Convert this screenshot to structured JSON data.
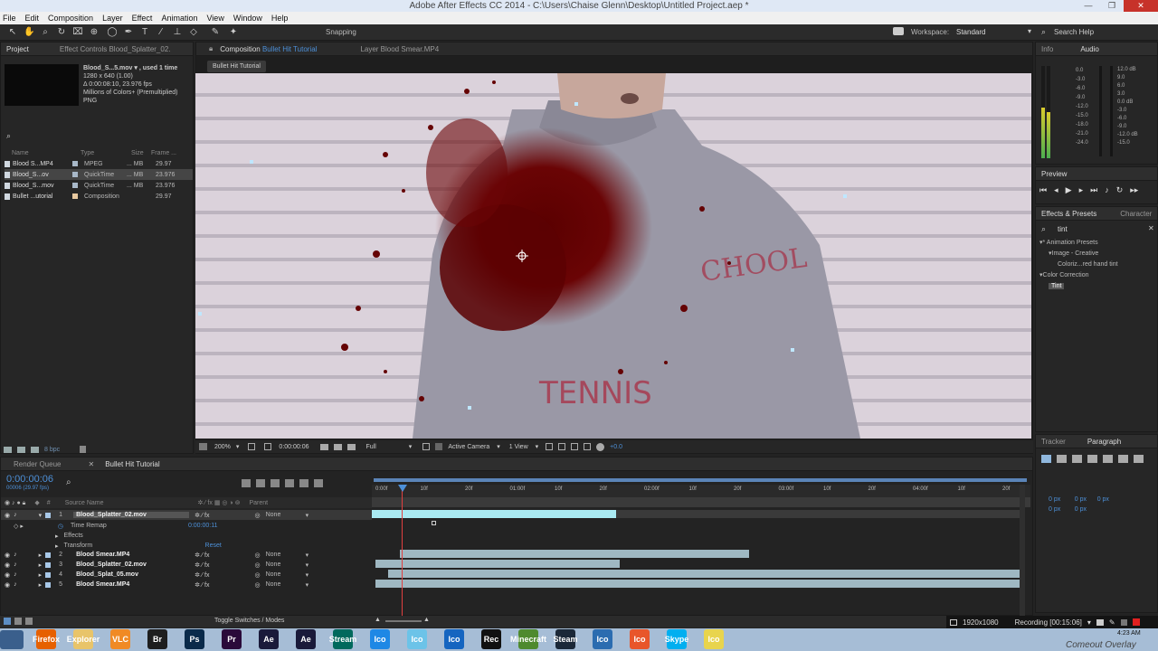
{
  "titlebar": {
    "title": "Adobe After Effects CC 2014 - C:\\Users\\Chaise Glenn\\Desktop\\Untitled Project.aep *"
  },
  "menu": [
    "File",
    "Edit",
    "Composition",
    "Layer",
    "Effect",
    "Animation",
    "View",
    "Window",
    "Help"
  ],
  "toolbar": {
    "snapping": "Snapping",
    "workspace_label": "Workspace:",
    "workspace_value": "Standard",
    "search_help": "Search Help"
  },
  "project": {
    "tab": "Project",
    "effect_controls_tab": "Effect Controls Blood_Splatter_02.",
    "selected_info": [
      "Blood_S...5.mov ▾ , used 1 time",
      "1280 x 640 (1.00)",
      "Δ 0:00:08:10, 23.976 fps",
      "Millions of Colors+ (Premultiplied)",
      "PNG"
    ],
    "columns": [
      "Name",
      "Type",
      "Size",
      "Frame ..."
    ],
    "items": [
      {
        "name": "Blood S...MP4",
        "type": "MPEG",
        "size": "... MB",
        "fps": "29.97",
        "color": "#a8b8c8"
      },
      {
        "name": "Blood_S...ov",
        "type": "QuickTime",
        "size": "... MB",
        "fps": "23.976",
        "color": "#a8b8c8"
      },
      {
        "name": "Blood_S...mov",
        "type": "QuickTime",
        "size": "... MB",
        "fps": "23.976",
        "color": "#a8b8c8"
      },
      {
        "name": "Bullet ...utorial",
        "type": "Composition",
        "size": "",
        "fps": "29.97",
        "color": "#e8c9a0"
      }
    ],
    "bpc": "8 bpc"
  },
  "composition": {
    "tab_label": "Composition",
    "tab_name": "Bullet Hit Tutorial",
    "layer_tab": "Layer Blood Smear.MP4",
    "subtab": "Bullet Hit Tutorial",
    "zoom": "200%",
    "timecode": "0:00:00:06",
    "resolution": "Full",
    "camera": "Active Camera",
    "view": "1 View",
    "exposure": "+0.0"
  },
  "info_panel": {
    "info_tab": "Info",
    "audio_tab": "Audio",
    "left_scale": [
      "0.0",
      "-3.0",
      "-6.0",
      "-9.0",
      "-12.0",
      "-15.0",
      "-18.0",
      "-21.0",
      "-24.0"
    ],
    "right_scale": [
      "12.0 dB",
      "9.0",
      "6.0",
      "3.0",
      "0.0 dB",
      "-3.0",
      "-6.0",
      "-9.0",
      "-12.0 dB",
      "-15.0"
    ],
    "meter_level_left": 0.55,
    "meter_level_right": 0.5
  },
  "preview": {
    "tab": "Preview"
  },
  "effects": {
    "tab": "Effects & Presets",
    "character_tab": "Character",
    "search": "tint",
    "tree": [
      {
        "label": "* Animation Presets",
        "indent": 0
      },
      {
        "label": "Image - Creative",
        "indent": 1
      },
      {
        "label": "Coloriz...red hand tint",
        "indent": 2
      },
      {
        "label": "Color Correction",
        "indent": 0
      },
      {
        "label": "Tint",
        "indent": 1
      }
    ]
  },
  "tracker": {
    "tab": "Tracker",
    "paragraph_tab": "Paragraph",
    "values": [
      "0 px",
      "0 px",
      "0 px",
      "0 px",
      "0 px"
    ]
  },
  "timeline": {
    "render_queue_tab": "Render Queue",
    "comp_tab": "Bullet Hit Tutorial",
    "current_time": "0:00:00:06",
    "fps_info": "00006 (29.97 fps)",
    "col_source": "Source Name",
    "col_parent": "Parent",
    "ruler": [
      "0:00f",
      "10f",
      "20f",
      "01:00f",
      "10f",
      "20f",
      "02:00f",
      "10f",
      "20f",
      "03:00f",
      "10f",
      "20f",
      "04:00f",
      "10f",
      "20f"
    ],
    "layers": [
      {
        "num": "1",
        "name": "Blood_Splatter_02.mov",
        "parent": "None",
        "selected": true
      },
      {
        "num": "2",
        "name": "Blood Smear.MP4",
        "parent": "None"
      },
      {
        "num": "3",
        "name": "Blood_Splatter_02.mov",
        "parent": "None"
      },
      {
        "num": "4",
        "name": "Blood_Splat_05.mov",
        "parent": "None"
      },
      {
        "num": "5",
        "name": "Blood Smear.MP4",
        "parent": "None"
      }
    ],
    "sub_time_remap": "Time Remap",
    "time_remap_value": "0:00:00:11",
    "sub_effects": "Effects",
    "sub_transform": "Transform",
    "reset": "Reset",
    "toggle": "Toggle Switches / Modes"
  },
  "statusbar": {
    "resolution": "1920x1080",
    "recording": "Recording [00:15:06]",
    "clock": "4:23 AM",
    "watermark": "Comeout Overlay"
  },
  "taskbar": [
    "Firefox",
    "Explorer",
    "VLC",
    "Br",
    "Ps",
    "Pr",
    "Ae",
    "Ae",
    "Stream",
    "Ico",
    "Ico",
    "Ico",
    "Rec",
    "Minecraft",
    "Steam",
    "Ico",
    "Ico",
    "Skype",
    "Ico"
  ],
  "colors": {
    "accent": "#2d8cf0",
    "selection": "#8fd8e8",
    "red": "#c7322a"
  }
}
